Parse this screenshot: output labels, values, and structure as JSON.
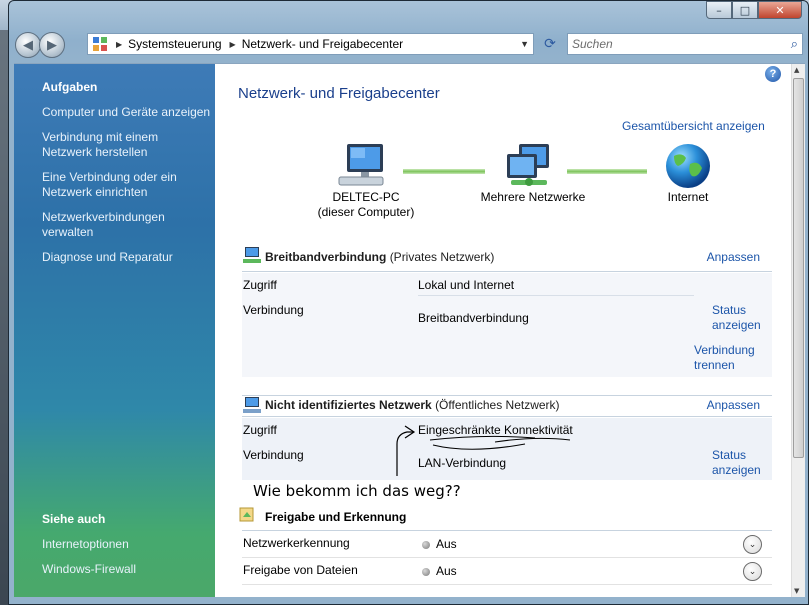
{
  "window": {
    "controls": {
      "minimize": "–",
      "maximize": "□",
      "close": "✕"
    }
  },
  "navbar": {
    "breadcrumb": [
      "Systemsteuerung",
      "Netzwerk- und Freigabecenter"
    ],
    "search_placeholder": "Suchen"
  },
  "sidebar": {
    "tasks_heading": "Aufgaben",
    "tasks": [
      "Computer und Geräte anzeigen",
      "Verbindung mit einem Netzwerk herstellen",
      "Eine Verbindung oder ein Netzwerk einrichten",
      "Netzwerkverbindungen verwalten",
      "Diagnose und Reparatur"
    ],
    "see_also_heading": "Siehe auch",
    "see_also": [
      "Internetoptionen",
      "Windows-Firewall"
    ]
  },
  "main": {
    "title": "Netzwerk- und Freigabecenter",
    "overview_link": "Gesamtübersicht anzeigen",
    "map": {
      "computer_name": "DELTEC-PC",
      "computer_sub": "(dieser Computer)",
      "networks": "Mehrere Netzwerke",
      "internet": "Internet"
    },
    "network1": {
      "name": "Breitbandverbindung",
      "type": "(Privates Netzwerk)",
      "customize": "Anpassen",
      "access_label": "Zugriff",
      "access_value": "Lokal und Internet",
      "connection_label": "Verbindung",
      "connection_value": "Breitbandverbindung",
      "status_link_1": "Status",
      "status_link_2": "anzeigen",
      "disconnect_1": "Verbindung",
      "disconnect_2": "trennen"
    },
    "network2": {
      "name": "Nicht identifiziertes Netzwerk",
      "type": "(Öffentliches Netzwerk)",
      "customize": "Anpassen",
      "access_label": "Zugriff",
      "access_value": "Eingeschränkte Konnektivität",
      "connection_label": "Verbindung",
      "connection_value": "LAN-Verbindung",
      "status_link_1": "Status",
      "status_link_2": "anzeigen"
    },
    "annotation": "Wie bekomm ich das weg??",
    "sharing": {
      "heading": "Freigabe und Erkennung",
      "rows": [
        {
          "label": "Netzwerkerkennung",
          "value": "Aus"
        },
        {
          "label": "Freigabe von Dateien",
          "value": "Aus"
        }
      ]
    }
  },
  "colors": {
    "link": "#1c55a9",
    "title": "#1a3f8c",
    "sidebar_top": "#3e7bb7",
    "sidebar_bottom": "#4ba869"
  }
}
